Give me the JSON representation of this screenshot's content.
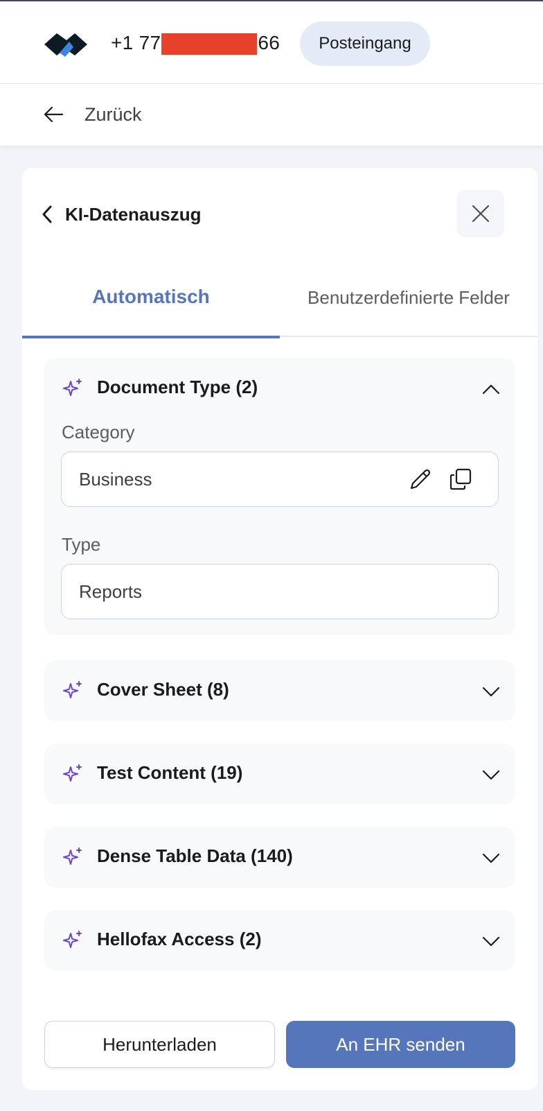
{
  "header": {
    "phone_prefix": "+1 77",
    "phone_suffix": "66",
    "inbox_label": "Posteingang"
  },
  "nav": {
    "back_label": "Zurück"
  },
  "panel": {
    "title": "KI-Datenauszug",
    "tabs": [
      {
        "label": "Automatisch",
        "active": true
      },
      {
        "label": "Benutzerdefinierte Felder",
        "active": false
      }
    ],
    "sections": [
      {
        "title": "Document Type (2)",
        "expanded": true,
        "fields": [
          {
            "label": "Category",
            "value": "Business"
          },
          {
            "label": "Type",
            "value": "Reports"
          }
        ]
      },
      {
        "title": "Cover Sheet (8)",
        "expanded": false
      },
      {
        "title": "Test Content (19)",
        "expanded": false
      },
      {
        "title": "Dense Table Data (140)",
        "expanded": false
      },
      {
        "title": "Hellofax Access (2)",
        "expanded": false
      }
    ],
    "actions": {
      "download_label": "Herunterladen",
      "send_label": "An EHR senden"
    }
  },
  "colors": {
    "accent": "#5576bb",
    "spark": "#6a42d6",
    "chip_bg": "#e4ebf7",
    "redaction": "#e8412b"
  },
  "icons": {
    "logo": "brand-logo-icon",
    "back": "arrow-left-icon",
    "panel_back": "chevron-left-icon",
    "close": "close-icon",
    "section": "sparkle-icon",
    "expanded": "chevron-up-icon",
    "collapsed": "chevron-down-icon",
    "edit": "pencil-icon",
    "copy": "copy-icon"
  }
}
